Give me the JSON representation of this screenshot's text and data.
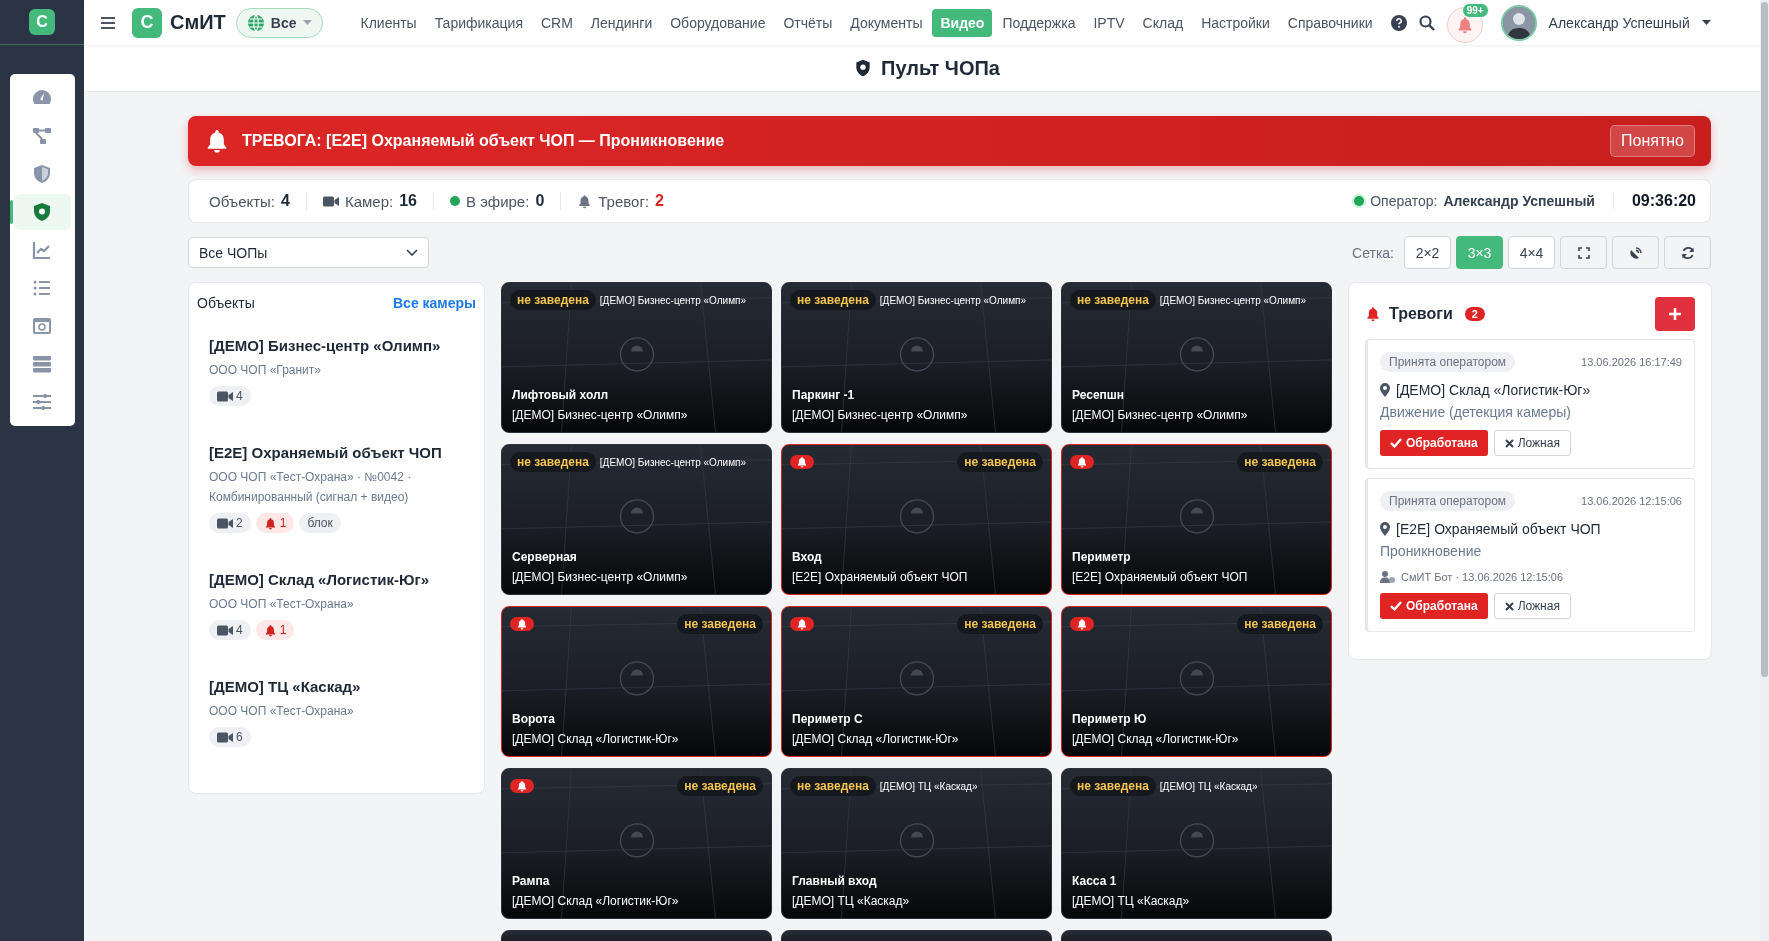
{
  "nav": {
    "sidebar_logo": "С",
    "brand_logo": "С",
    "brand": "СмИТ",
    "scope": "Все",
    "items": [
      {
        "label": "Клиенты",
        "selected": false
      },
      {
        "label": "Тарификация",
        "selected": false
      },
      {
        "label": "CRM",
        "selected": false
      },
      {
        "label": "Лендинги",
        "selected": false
      },
      {
        "label": "Оборудование",
        "selected": false
      },
      {
        "label": "Отчёты",
        "selected": false
      },
      {
        "label": "Документы",
        "selected": false
      },
      {
        "label": "Видео",
        "selected": true
      },
      {
        "label": "Поддержка",
        "selected": false
      },
      {
        "label": "IPTV",
        "selected": false
      },
      {
        "label": "Склад",
        "selected": false
      },
      {
        "label": "Настройки",
        "selected": false
      },
      {
        "label": "Справочники",
        "selected": false
      }
    ],
    "notifications": "99+",
    "user": "Александр Успешный"
  },
  "sidebar": {
    "items": [
      {
        "selected": false
      },
      {
        "selected": false
      },
      {
        "selected": false
      },
      {
        "selected": true
      },
      {
        "selected": false
      },
      {
        "selected": false
      },
      {
        "selected": false
      },
      {
        "selected": false
      },
      {
        "selected": false
      }
    ]
  },
  "page": {
    "title": "Пульт ЧОПа"
  },
  "alert": {
    "text": "ТРЕВОГА: [E2E] Охраняемый объект ЧОП — Проникновение",
    "button": "Понятно"
  },
  "stats": [
    {
      "kind": "plain",
      "label": "Объекты:",
      "value": "4"
    },
    {
      "kind": "camera",
      "label": "Камер:",
      "value": "16"
    },
    {
      "kind": "live",
      "label": "В эфире:",
      "value": "0"
    },
    {
      "kind": "alarm",
      "label": "Тревог:",
      "value": "2"
    }
  ],
  "operator": {
    "label": "Оператор:",
    "name": "Александр Успешный"
  },
  "clock": "09:36:20",
  "filter": {
    "value": "Все ЧОПы"
  },
  "grid_controls": {
    "label": "Сетка:",
    "options": [
      {
        "label": "2×2",
        "selected": false
      },
      {
        "label": "3×3",
        "selected": true
      },
      {
        "label": "4×4",
        "selected": false
      }
    ]
  },
  "objects": {
    "title": "Объекты",
    "link": "Все камеры",
    "items": [
      {
        "name": "[ДЕМО] Бизнес-центр «Олимп»",
        "subtitle": "ООО ЧОП «Гранит»",
        "chips": [
          {
            "kind": "cameras",
            "text": "4"
          }
        ]
      },
      {
        "name": "[E2E] Охраняемый объект ЧОП",
        "subtitle": "ООО ЧОП «Тест-Охрана» · №0042 · Комбинированный (сигнал + видео)",
        "chips": [
          {
            "kind": "cameras",
            "text": "2"
          },
          {
            "kind": "alarms",
            "text": "1"
          },
          {
            "kind": "tag",
            "text": "блок"
          }
        ]
      },
      {
        "name": "[ДЕМО] Склад «Логистик-Юг»",
        "subtitle": "ООО ЧОП «Тест-Охрана»",
        "chips": [
          {
            "kind": "cameras",
            "text": "4"
          },
          {
            "kind": "alarms",
            "text": "1"
          }
        ]
      },
      {
        "name": "[ДЕМО] ТЦ «Каскад»",
        "subtitle": "ООО ЧОП «Тест-Охрана»",
        "chips": [
          {
            "kind": "cameras",
            "text": "6"
          }
        ]
      }
    ]
  },
  "cameras": [
    {
      "kind": "tile",
      "top_label": "[ДЕМО] Бизнес-центр «Олимп»",
      "status": "не заведена",
      "alarm": false,
      "outlined": false,
      "name": "Лифтовый холл",
      "object": "[ДЕМО] Бизнес-центр «Олимп»"
    },
    {
      "kind": "tile",
      "top_label": "[ДЕМО] Бизнес-центр «Олимп»",
      "status": "не заведена",
      "alarm": false,
      "outlined": false,
      "name": "Паркинг -1",
      "object": "[ДЕМО] Бизнес-центр «Олимп»"
    },
    {
      "kind": "tile",
      "top_label": "[ДЕМО] Бизнес-центр «Олимп»",
      "status": "не заведена",
      "alarm": false,
      "outlined": false,
      "name": "Ресепшн",
      "object": "[ДЕМО] Бизнес-центр «Олимп»"
    },
    {
      "kind": "tile",
      "top_label": "[ДЕМО] Бизнес-центр «Олимп»",
      "status": "не заведена",
      "alarm": false,
      "outlined": false,
      "name": "Серверная",
      "object": "[ДЕМО] Бизнес-центр «Олимп»"
    },
    {
      "kind": "tile",
      "status": "не заведена",
      "alarm": true,
      "outlined": true,
      "name": "Вход",
      "object": "[E2E] Охраняемый объект ЧОП"
    },
    {
      "kind": "tile",
      "status": "не заведена",
      "alarm": true,
      "outlined": true,
      "name": "Периметр",
      "object": "[E2E] Охраняемый объект ЧОП"
    },
    {
      "kind": "tile",
      "status": "не заведена",
      "alarm": true,
      "outlined": true,
      "name": "Ворота",
      "object": "[ДЕМО] Склад «Логистик-Юг»"
    },
    {
      "kind": "tile",
      "status": "не заведена",
      "alarm": true,
      "outlined": true,
      "name": "Периметр С",
      "object": "[ДЕМО] Склад «Логистик-Юг»"
    },
    {
      "kind": "tile",
      "status": "не заведена",
      "alarm": true,
      "outlined": true,
      "name": "Периметр Ю",
      "object": "[ДЕМО] Склад «Логистик-Юг»"
    },
    {
      "kind": "tile",
      "status": "не заведена",
      "alarm": true,
      "outlined": false,
      "name": "Рампа",
      "object": "[ДЕМО] Склад «Логистик-Юг»"
    },
    {
      "kind": "tile",
      "top_label": "[ДЕМО] ТЦ «Каскад»",
      "status": "не заведена",
      "alarm": false,
      "outlined": false,
      "name": "Главный вход",
      "object": "[ДЕМО] ТЦ «Каскад»"
    },
    {
      "kind": "tile",
      "top_label": "[ДЕМО] ТЦ «Каскад»",
      "status": "не заведена",
      "alarm": false,
      "outlined": false,
      "name": "Касса 1",
      "object": "[ДЕМО] ТЦ «Каскад»"
    },
    {
      "kind": "cut"
    },
    {
      "kind": "cut"
    },
    {
      "kind": "cut"
    }
  ],
  "alarms": {
    "title": "Тревоги",
    "count": "2",
    "items": [
      {
        "status": "Принята оператором",
        "time": "13.06.2026 16:17:49",
        "object": "[ДЕМО] Склад «Логистик-Юг»",
        "event": "Движение (детекция камеры)",
        "actions": [
          {
            "kind": "confirm",
            "label": "Обработана"
          },
          {
            "kind": "false",
            "label": "Ложная"
          }
        ]
      },
      {
        "status": "Принята оператором",
        "time": "13.06.2026 12:15:06",
        "object": "[E2E] Охраняемый объект ЧОП",
        "event": "Проникновение",
        "author": "СмИТ Бот · 13.06.2026 12:15:06",
        "actions": [
          {
            "kind": "confirm",
            "label": "Обработана"
          },
          {
            "kind": "false",
            "label": "Ложная"
          }
        ]
      }
    ]
  }
}
